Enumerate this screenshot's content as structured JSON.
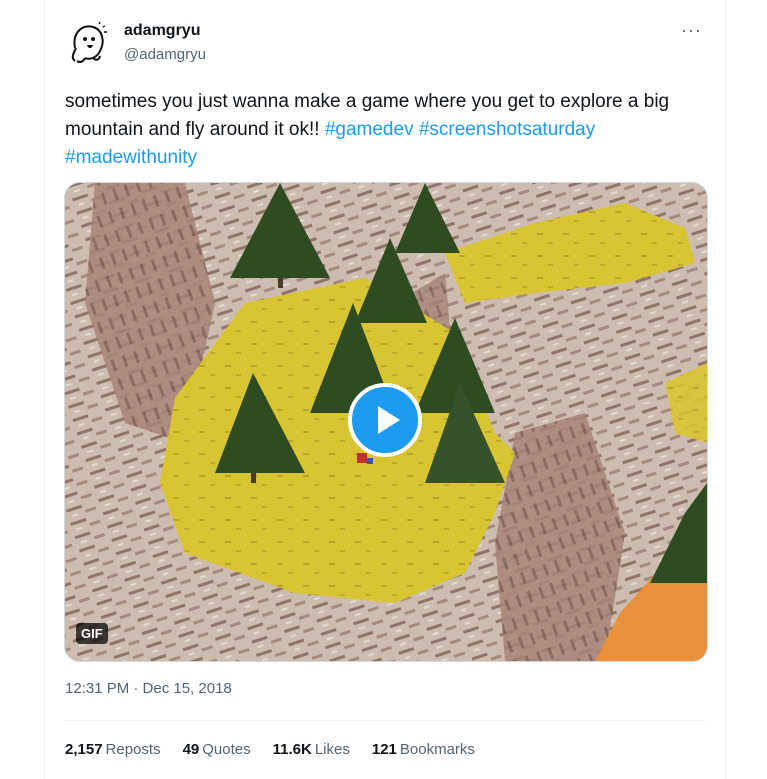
{
  "author": {
    "name": "adamgryu",
    "handle": "@adamgryu",
    "avatar_icon": "doodle-face-avatar"
  },
  "more_icon": "more-horizontal-icon",
  "more_glyph": "···",
  "tweet": {
    "text_plain": "sometimes you just wanna make a game where you get to explore a big mountain and fly around it ok!! ",
    "hashtags": [
      "#gamedev",
      "#screenshotsaturday",
      "#madewithunity"
    ]
  },
  "media": {
    "badge": "GIF",
    "play_icon": "play-icon",
    "accent": "#1d9bf0"
  },
  "timestamp": "12:31 PM · Dec 15, 2018",
  "stats": [
    {
      "count": "2,157",
      "label": "Reposts"
    },
    {
      "count": "49",
      "label": "Quotes"
    },
    {
      "count": "11.6K",
      "label": "Likes"
    },
    {
      "count": "121",
      "label": "Bookmarks"
    }
  ]
}
